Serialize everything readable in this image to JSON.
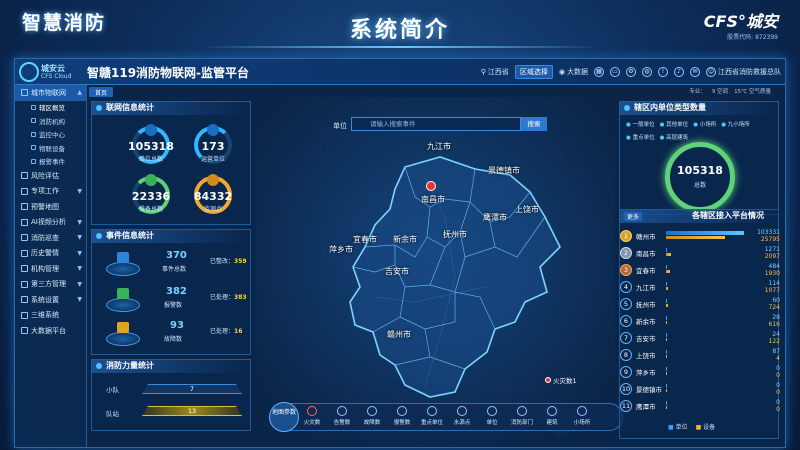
{
  "slide": {
    "brand_left": "智慧消防",
    "title": "系统简介",
    "brand_right_logo": "CFS°城安",
    "brand_right_code": "股票代码: 872399"
  },
  "app": {
    "logo_cn": "城安云",
    "logo_en": "CFS Cloud",
    "title": "智赣119消防物联网-监管平台",
    "topbar": {
      "location": "江西省",
      "active_tab": "区域选择",
      "screen": "大数据",
      "user": "江西省消防救援总队"
    }
  },
  "sidebar": {
    "group": "城市物联网",
    "subitems": [
      "辖区概览",
      "消防机构",
      "监控中心",
      "物联设备",
      "报警事件"
    ],
    "items": [
      "风险评估",
      "专项工作",
      "预警地图",
      "AI视频分析",
      "消防巡查",
      "历史警情",
      "机构管理",
      "第三方管理",
      "系统设置",
      "三维系统",
      "大数据平台"
    ]
  },
  "breadcrumb": "首页",
  "weather": [
    "专业：",
    "9 空调",
    "15℃ 空气质量"
  ],
  "iot": {
    "title": "联网信息统计",
    "units_total": {
      "value": "105318",
      "label": "单位总数"
    },
    "ops_units": {
      "value": "173",
      "label": "运营单位"
    },
    "devices_total": {
      "value": "22336",
      "label": "设备总数"
    },
    "monitor_points": {
      "value": "84332",
      "label": "监测点"
    }
  },
  "events": {
    "title": "事件信息统计",
    "event_count": {
      "value": "370",
      "label": "事件总数"
    },
    "rectified": {
      "label": "已整改：",
      "value": "359"
    },
    "alarm_count": {
      "value": "382",
      "label": "报警数"
    },
    "handled": {
      "label": "已处理：",
      "value": "383"
    },
    "fault_count": {
      "value": "93",
      "label": "故障数"
    },
    "handled2": {
      "label": "已处理：",
      "value": "16"
    }
  },
  "force": {
    "title": "消防力量统计",
    "rows": [
      {
        "label": "小队",
        "value": "7"
      },
      {
        "label": "队站",
        "value": "13"
      }
    ]
  },
  "map": {
    "search_label": "单位",
    "search_placeholder": "请输入搜索事件",
    "search_button": "搜索",
    "cities": [
      "九江市",
      "景德镇市",
      "南昌市",
      "鹰潭市",
      "上饶市",
      "宜春市",
      "新余市",
      "萍乡市",
      "抚州市",
      "吉安市",
      "赣州市"
    ],
    "fire_label": "火灾数1"
  },
  "bottom_bar": {
    "circle_label": "地图参数",
    "items": [
      "火灾数",
      "告警数",
      "故障数",
      "报警数",
      "重点单位",
      "水源点",
      "单位",
      "消防部门",
      "建筑",
      "小场所"
    ]
  },
  "unit_types": {
    "title": "辖区内单位类型数量",
    "legend": [
      "一般单位",
      "其他单位",
      "小场所",
      "九小场所",
      "重点单位",
      "高层建筑"
    ],
    "total": "105318",
    "total_label": "总数"
  },
  "access": {
    "title": "各辖区接入平台情况",
    "tag": "更多",
    "rows": [
      {
        "rank": "1",
        "name": "赣州市",
        "v1": "103331",
        "v2": "25795"
      },
      {
        "rank": "2",
        "name": "南昌市",
        "v1": "1271",
        "v2": "2097"
      },
      {
        "rank": "3",
        "name": "宜春市",
        "v1": "484",
        "v2": "1930"
      },
      {
        "rank": "4",
        "name": "九江市",
        "v1": "114",
        "v2": "1077"
      },
      {
        "rank": "5",
        "name": "抚州市",
        "v1": "60",
        "v2": "724"
      },
      {
        "rank": "6",
        "name": "新余市",
        "v1": "28",
        "v2": "616"
      },
      {
        "rank": "7",
        "name": "吉安市",
        "v1": "24",
        "v2": "122"
      },
      {
        "rank": "8",
        "name": "上饶市",
        "v1": "87",
        "v2": "4"
      },
      {
        "rank": "9",
        "name": "萍乡市",
        "v1": "0",
        "v2": "0"
      },
      {
        "rank": "10",
        "name": "景德镇市",
        "v1": "0",
        "v2": "0"
      },
      {
        "rank": "11",
        "name": "鹰潭市",
        "v1": "0",
        "v2": "0"
      }
    ],
    "legend_unit": "单位",
    "legend_device": "设备",
    "bar_colors": {
      "unit": "#3aa2ff",
      "device": "#f3b33a"
    }
  }
}
